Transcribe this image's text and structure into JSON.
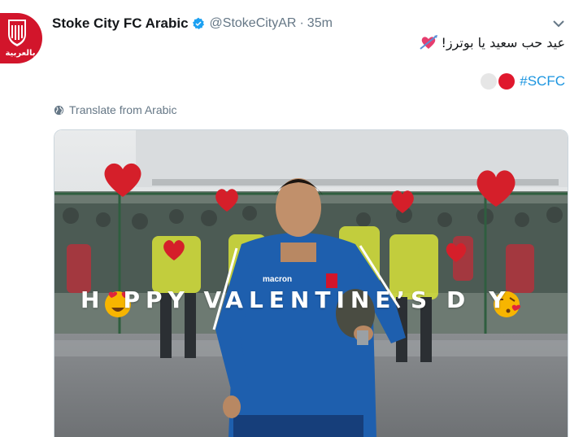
{
  "tweet": {
    "display_name": "Stoke City FC Arabic",
    "handle": "@StokeCityAR",
    "separator": "·",
    "time": "35m",
    "text_arabic": "عيد حب سعيد يا بوترز!",
    "hashtag": "#SCFC",
    "translate_label": "Translate from Arabic",
    "avatar_text": "بالعربية",
    "verified_icon": "verified-badge-icon",
    "caret_icon": "chevron-down-icon",
    "globe_icon": "globe-icon",
    "heart_emoji_icon": "heart-with-arrow-emoji-icon"
  },
  "media": {
    "overlay_text": "HAPPY VALENTINE'S DAY",
    "overlay_segments": [
      "H",
      "PPY VALENTINE’S D",
      "Y"
    ],
    "colors": {
      "accent": "#1b95e0",
      "brand_red": "#d2152b",
      "heart_red": "#d51f2a",
      "jacket_blue": "#1e5fae"
    }
  }
}
